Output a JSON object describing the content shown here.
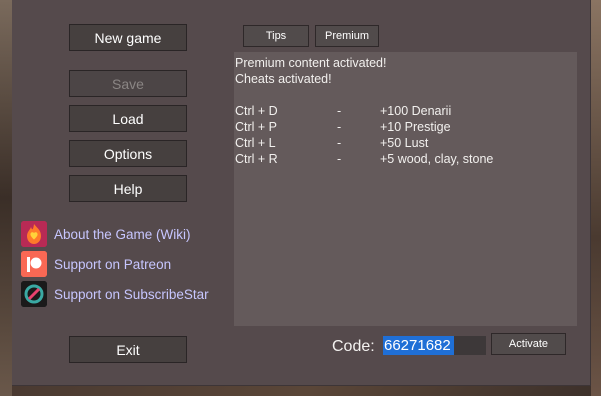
{
  "menu": {
    "new_game": "New game",
    "save": "Save",
    "load": "Load",
    "options": "Options",
    "help": "Help",
    "exit": "Exit"
  },
  "top_buttons": {
    "tips": "Tips",
    "premium": "Premium"
  },
  "info_text": {
    "line1": "Premium content activated!",
    "line2": "Cheats activated!",
    "shortcuts": [
      {
        "keys": "Ctrl + D",
        "sep": "-",
        "effect": "+100 Denarii"
      },
      {
        "keys": "Ctrl + P",
        "sep": "-",
        "effect": "+10 Prestige"
      },
      {
        "keys": "Ctrl + L",
        "sep": "-",
        "effect": "+50 Lust"
      },
      {
        "keys": "Ctrl + R",
        "sep": "-",
        "effect": "+5 wood, clay, stone"
      }
    ]
  },
  "links": {
    "wiki": {
      "label": "About the Game (Wiki)",
      "icon": "fire-heart-icon"
    },
    "patreon": {
      "label": "Support on Patreon",
      "icon": "patreon-icon"
    },
    "subscribestar": {
      "label": "Support on SubscribeStar",
      "icon": "subscribestar-icon"
    }
  },
  "code": {
    "label": "Code:",
    "value": "66271682",
    "activate": "Activate"
  },
  "colors": {
    "panel": "#554a4c",
    "textbox": "#645a5b",
    "link": "#c7c6ff",
    "selection": "#1f6fd6"
  }
}
